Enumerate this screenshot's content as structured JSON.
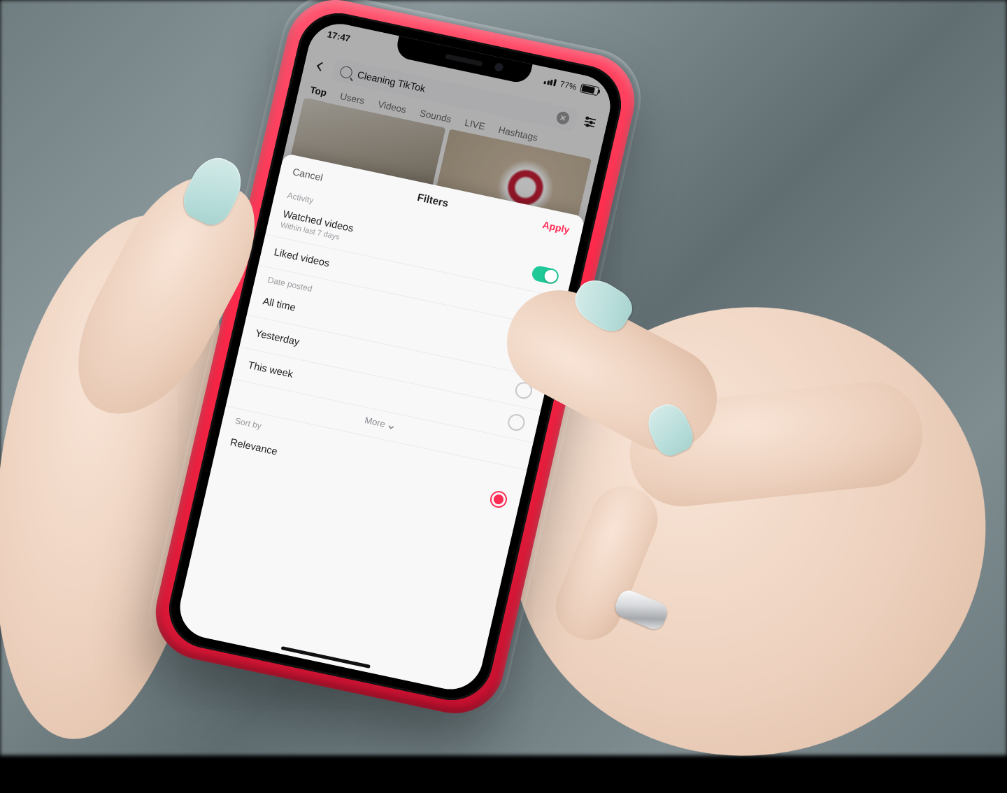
{
  "status": {
    "time": "17:47",
    "battery_pct": "77%"
  },
  "search": {
    "query": "Cleaning TikTok"
  },
  "tabs": [
    "Top",
    "Users",
    "Videos",
    "Sounds",
    "LIVE",
    "Hashtags"
  ],
  "active_tab": "Top",
  "sheet": {
    "cancel": "Cancel",
    "title": "Filters",
    "apply": "Apply",
    "sections": {
      "activity": {
        "label": "Activity",
        "watched": {
          "label": "Watched videos",
          "sub": "Within last 7 days",
          "on": true
        },
        "liked": {
          "label": "Liked videos",
          "on": false
        }
      },
      "date_posted": {
        "label": "Date posted",
        "options": [
          {
            "label": "All time",
            "selected": true
          },
          {
            "label": "Yesterday",
            "selected": false
          },
          {
            "label": "This week",
            "selected": false
          }
        ],
        "more": "More"
      },
      "sort_by": {
        "label": "Sort by",
        "options": [
          {
            "label": "Relevance",
            "selected": true
          }
        ]
      }
    }
  }
}
